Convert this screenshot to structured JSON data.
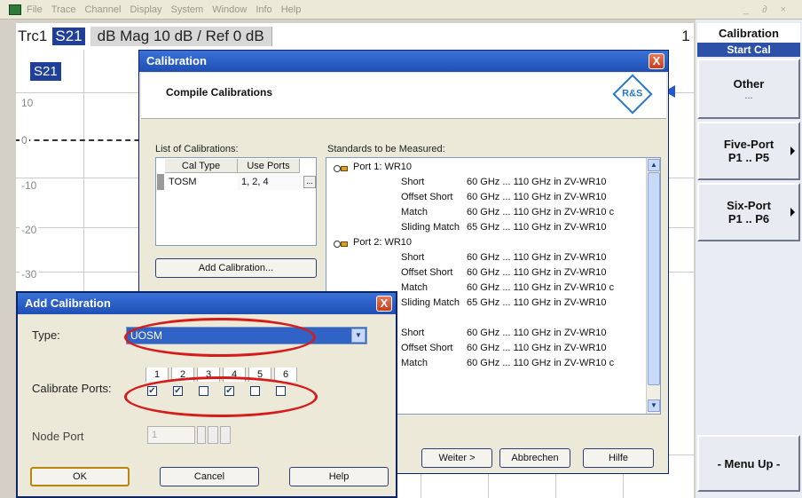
{
  "menu": {
    "items": [
      "File",
      "Trace",
      "Channel",
      "Display",
      "System",
      "Window",
      "Info",
      "Help"
    ],
    "window_controls": "_ ∂ ×"
  },
  "trace": {
    "name": "Trc1",
    "param": "S21",
    "format": "dB Mag",
    "scale": "10 dB /",
    "ref": "Ref 0 dB",
    "channel_num": "1",
    "y_labels": [
      "10",
      "0",
      "-10",
      "-20",
      "-30"
    ],
    "badge": "S21"
  },
  "softkeys": {
    "title": "Calibration",
    "subtitle": "Start Cal",
    "other": {
      "label": "Other",
      "sub": "..."
    },
    "five_port": {
      "label": "Five-Port",
      "sub": "P1 .. P5"
    },
    "six_port": {
      "label": "Six-Port",
      "sub": "P1 .. P6"
    },
    "menu_up": "- Menu Up -"
  },
  "cal_dialog": {
    "title": "Calibration",
    "close": "X",
    "heading": "Compile Calibrations",
    "logo": "R&S",
    "list_label": "List of Calibrations:",
    "std_label": "Standards to be Measured:",
    "table": {
      "headers": [
        "Cal Type",
        "Use Ports"
      ],
      "row": {
        "type": "TOSM",
        "ports": "1, 2, 4",
        "ellipsis": "..."
      }
    },
    "add_button": "Add Calibration...",
    "buttons": {
      "next": "Weiter >",
      "cancel": "Abbrechen",
      "help": "Hilfe"
    },
    "standards": [
      {
        "kind": "port",
        "text": "Port 1: WR10"
      },
      {
        "kind": "std",
        "name": "Short",
        "range": "60 GHz ... 110 GHz in ZV-WR10"
      },
      {
        "kind": "std",
        "name": "Offset Short",
        "range": "60 GHz ... 110 GHz in ZV-WR10"
      },
      {
        "kind": "std",
        "name": "Match",
        "range": "60 GHz ... 110 GHz in ZV-WR10 c"
      },
      {
        "kind": "std",
        "name": "Sliding Match",
        "range": "65 GHz ... 110 GHz in ZV-WR10"
      },
      {
        "kind": "port",
        "text": "Port 2: WR10"
      },
      {
        "kind": "std",
        "name": "Short",
        "range": "60 GHz ... 110 GHz in ZV-WR10"
      },
      {
        "kind": "std",
        "name": "Offset Short",
        "range": "60 GHz ... 110 GHz in ZV-WR10"
      },
      {
        "kind": "std",
        "name": "Match",
        "range": "60 GHz ... 110 GHz in ZV-WR10 c"
      },
      {
        "kind": "std",
        "name": "Sliding Match",
        "range": "65 GHz ... 110 GHz in ZV-WR10"
      },
      {
        "kind": "port",
        "text": ": WR10"
      },
      {
        "kind": "std",
        "name": "Short",
        "range": "60 GHz ... 110 GHz in ZV-WR10"
      },
      {
        "kind": "std",
        "name": "Offset Short",
        "range": "60 GHz ... 110 GHz in ZV-WR10"
      },
      {
        "kind": "std",
        "name": "Match",
        "range": "60 GHz ... 110 GHz in ZV-WR10 c"
      }
    ]
  },
  "add_dialog": {
    "title": "Add Calibration",
    "close": "X",
    "type_label": "Type:",
    "type_value": "UOSM",
    "ports_label": "Calibrate Ports:",
    "port_numbers": [
      "1",
      "2",
      "3",
      "4",
      "5",
      "6"
    ],
    "port_checked": [
      true,
      true,
      false,
      true,
      false,
      false
    ],
    "check_mark": "✔",
    "node_label": "Node Port",
    "node_value": "1",
    "buttons": {
      "ok": "OK",
      "cancel": "Cancel",
      "help": "Help"
    }
  },
  "colors": {
    "accent_blue": "#1f3f9a",
    "titlebar_blue": "#1f4fb5",
    "highlight_red": "#d61b1b"
  }
}
